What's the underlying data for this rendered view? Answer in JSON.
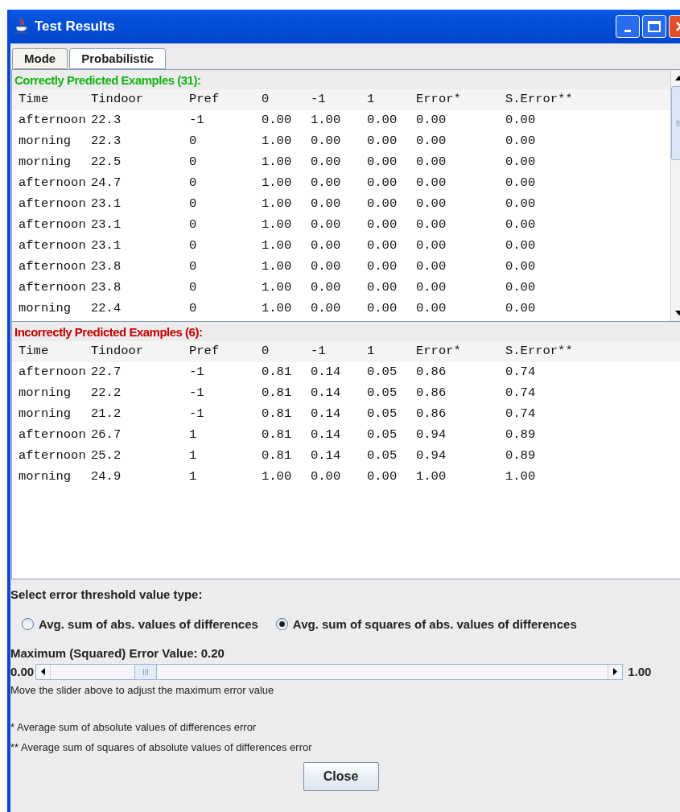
{
  "window": {
    "title": "Test Results"
  },
  "tabs": [
    {
      "label": "Mode",
      "selected": false
    },
    {
      "label": "Probabilistic",
      "selected": true
    }
  ],
  "panels": [
    {
      "kind": "correct",
      "title": "Correctly Predicted Examples (31):",
      "scrollbar": true,
      "columns": [
        "Time",
        "Tindoor",
        "Pref",
        "0",
        "-1",
        "1",
        "Error*",
        "S.Error**"
      ],
      "rows": [
        [
          "afternoon",
          "22.3",
          "-1",
          "0.00",
          "1.00",
          "0.00",
          "0.00",
          "0.00"
        ],
        [
          "morning",
          "22.3",
          "0",
          "1.00",
          "0.00",
          "0.00",
          "0.00",
          "0.00"
        ],
        [
          "morning",
          "22.5",
          "0",
          "1.00",
          "0.00",
          "0.00",
          "0.00",
          "0.00"
        ],
        [
          "afternoon",
          "24.7",
          "0",
          "1.00",
          "0.00",
          "0.00",
          "0.00",
          "0.00"
        ],
        [
          "afternoon",
          "23.1",
          "0",
          "1.00",
          "0.00",
          "0.00",
          "0.00",
          "0.00"
        ],
        [
          "afternoon",
          "23.1",
          "0",
          "1.00",
          "0.00",
          "0.00",
          "0.00",
          "0.00"
        ],
        [
          "afternoon",
          "23.1",
          "0",
          "1.00",
          "0.00",
          "0.00",
          "0.00",
          "0.00"
        ],
        [
          "afternoon",
          "23.8",
          "0",
          "1.00",
          "0.00",
          "0.00",
          "0.00",
          "0.00"
        ],
        [
          "afternoon",
          "23.8",
          "0",
          "1.00",
          "0.00",
          "0.00",
          "0.00",
          "0.00"
        ],
        [
          "morning",
          "22.4",
          "0",
          "1.00",
          "0.00",
          "0.00",
          "0.00",
          "0.00"
        ]
      ]
    },
    {
      "kind": "incorrect",
      "title": "Incorrectly Predicted Examples (6):",
      "scrollbar": false,
      "columns": [
        "Time",
        "Tindoor",
        "Pref",
        "0",
        "-1",
        "1",
        "Error*",
        "S.Error**"
      ],
      "rows": [
        [
          "afternoon",
          "22.7",
          "-1",
          "0.81",
          "0.14",
          "0.05",
          "0.86",
          "0.74"
        ],
        [
          "morning",
          "22.2",
          "-1",
          "0.81",
          "0.14",
          "0.05",
          "0.86",
          "0.74"
        ],
        [
          "morning",
          "21.2",
          "-1",
          "0.81",
          "0.14",
          "0.05",
          "0.86",
          "0.74"
        ],
        [
          "afternoon",
          "26.7",
          "1",
          "0.81",
          "0.14",
          "0.05",
          "0.94",
          "0.89"
        ],
        [
          "afternoon",
          "25.2",
          "1",
          "0.81",
          "0.14",
          "0.05",
          "0.94",
          "0.89"
        ],
        [
          "morning",
          "24.9",
          "1",
          "1.00",
          "0.00",
          "0.00",
          "1.00",
          "1.00"
        ]
      ]
    }
  ],
  "threshold": {
    "label": "Select error threshold value type:",
    "options": [
      {
        "label": "Avg. sum of abs. values of differences",
        "selected": false
      },
      {
        "label": "Avg. sum of squares of abs. values of differences",
        "selected": true
      }
    ]
  },
  "slider": {
    "label": "Maximum (Squared) Error Value: 0.20",
    "min": "0.00",
    "max": "1.00",
    "level": 0.2,
    "hint": "Move the slider above to adjust the maximum error value"
  },
  "footnotes": [
    "* Average sum of absolute values of differences error",
    "** Average sum of squares of absolute values of differences error"
  ],
  "buttons": [
    "Close"
  ]
}
